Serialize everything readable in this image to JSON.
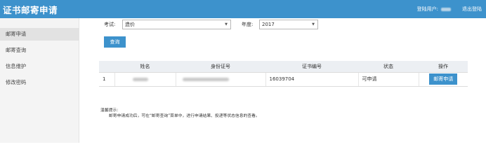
{
  "header": {
    "title": "证书邮寄申请",
    "user_label": "登陆用户:",
    "logout": "退出登陆"
  },
  "sidebar": {
    "items": [
      {
        "label": "邮寄申请",
        "active": true
      },
      {
        "label": "邮寄查询",
        "active": false
      },
      {
        "label": "信息维护",
        "active": false
      },
      {
        "label": "修改密码",
        "active": false
      }
    ]
  },
  "filters": {
    "exam_label": "考试:",
    "exam_value": "造价",
    "year_label": "年度:",
    "year_value": "2017",
    "query_button": "查询"
  },
  "table": {
    "headers": [
      "",
      "姓名",
      "身份证号",
      "证书编号",
      "状态",
      "操作"
    ],
    "rows": [
      {
        "index": "1",
        "cert_no": "16039704",
        "status": "可申请",
        "action": "邮寄申请"
      }
    ]
  },
  "tips": {
    "title": "温馨提示:",
    "text": "邮寄申请成功后，可在“邮寄查询”菜单中，进行申请结果、投递等状态信息的查看。"
  },
  "colors": {
    "accent": "#3d92cc"
  }
}
